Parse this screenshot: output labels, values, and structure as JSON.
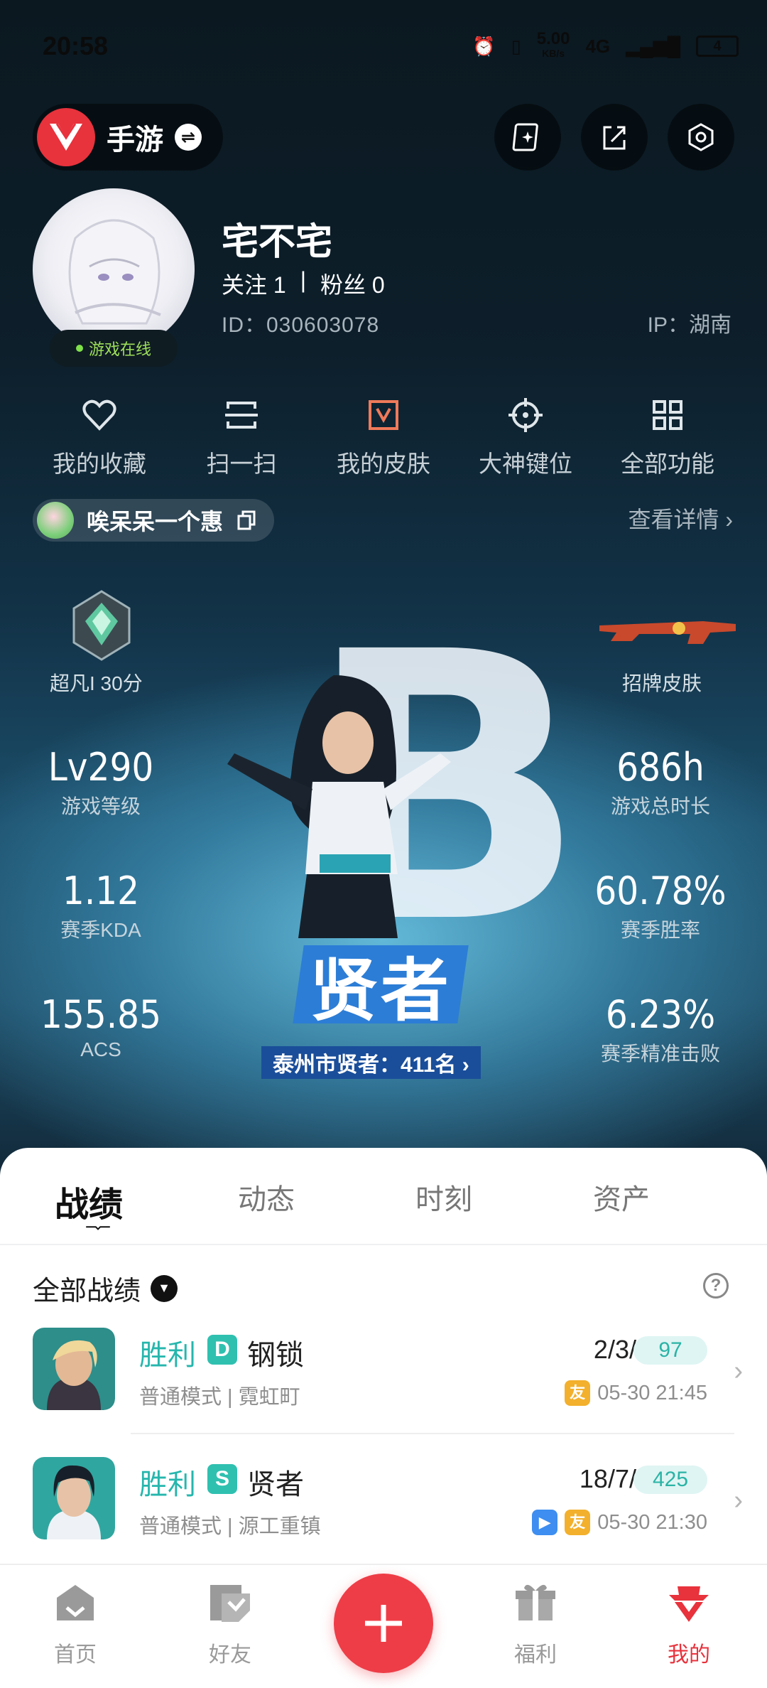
{
  "status_bar": {
    "time": "20:58",
    "speed_value": "5.00",
    "speed_unit": "KB/s",
    "network": "4G",
    "battery": "4"
  },
  "header": {
    "game_name": "手游"
  },
  "profile": {
    "nickname": "宅不宅",
    "follow_label": "关注 1",
    "separator": "|",
    "fans_label": "粉丝 0",
    "id_label": "ID：030603078",
    "ip_label": "IP：湖南",
    "online_status": "游戏在线"
  },
  "quick_actions": [
    {
      "label": "我的收藏",
      "icon": "heart-icon"
    },
    {
      "label": "扫一扫",
      "icon": "scan-icon"
    },
    {
      "label": "我的皮肤",
      "icon": "skin-icon"
    },
    {
      "label": "大神键位",
      "icon": "crosshair-icon"
    },
    {
      "label": "全部功能",
      "icon": "grid-icon"
    }
  ],
  "agent": {
    "name": "唉呆呆一个惠",
    "detail_link": "查看详情 ›"
  },
  "stats": {
    "rank_label": "超凡I 30分",
    "skin_label": "招牌皮肤",
    "level_value": "Lv290",
    "level_label": "游戏等级",
    "hours_value": "686h",
    "hours_label": "游戏总时长",
    "kda_value": "1.12",
    "kda_label": "赛季KDA",
    "winrate_value": "60.78%",
    "winrate_label": "赛季胜率",
    "acs_value": "155.85",
    "acs_label": "ACS",
    "fb_value": "6.23%",
    "fb_label": "赛季精准击败"
  },
  "hero": {
    "letter": "B",
    "rank_title": "贤者",
    "city_rank": "泰州市贤者：411名 ›"
  },
  "tabs": [
    "战绩",
    "动态",
    "时刻",
    "资产"
  ],
  "filter": {
    "label": "全部战绩",
    "caret": "▼",
    "help": "?"
  },
  "matches": [
    {
      "result": "胜利",
      "badge": "D",
      "agent": "钢锁",
      "sub": "普通模式 | 霓虹町",
      "kda": "2/3/2",
      "acs": "97",
      "time": "05-30 21:45",
      "tags": [
        "友"
      ]
    },
    {
      "result": "胜利",
      "badge": "S",
      "agent": "贤者",
      "sub": "普通模式 | 源工重镇",
      "kda": "18/7/4",
      "acs": "425",
      "time": "05-30 21:30",
      "tags": [
        "友"
      ]
    }
  ],
  "bottom_nav": [
    {
      "label": "首页",
      "icon": "home-icon"
    },
    {
      "label": "好友",
      "icon": "friends-icon"
    },
    {
      "label": "福利",
      "icon": "gift-icon"
    },
    {
      "label": "我的",
      "icon": "profile-icon"
    }
  ],
  "colors": {
    "accent_red": "#e8323c",
    "win_teal": "#25b6ad",
    "rank_blue": "#2c7dd6"
  }
}
